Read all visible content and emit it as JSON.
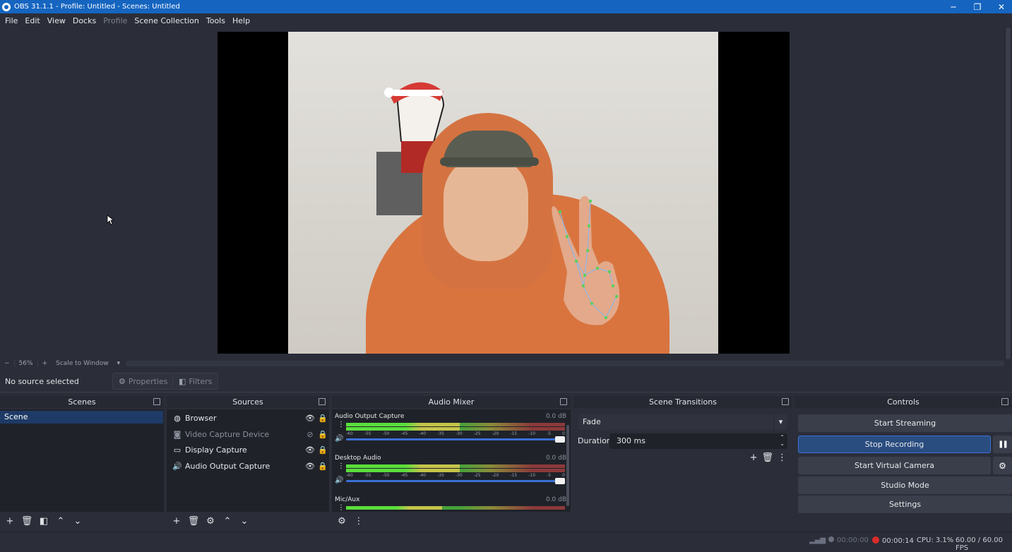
{
  "window": {
    "title": "OBS 31.1.1 - Profile: Untitled - Scenes: Untitled",
    "min_glyph": "─",
    "restore_glyph": "❐",
    "close_glyph": "✕"
  },
  "menubar": {
    "items": [
      "File",
      "Edit",
      "View",
      "Docks",
      "Profile",
      "Scene Collection",
      "Tools",
      "Help"
    ]
  },
  "zoombar": {
    "zoom_out": "−",
    "zoom_level": "56%",
    "zoom_in": "+",
    "scale_mode": "Scale to Window",
    "caret": "▾"
  },
  "source_toolbar": {
    "status": "No source selected",
    "properties_label": "Properties",
    "filters_label": "Filters"
  },
  "scenes": {
    "header": "Scenes",
    "items": [
      "Scene"
    ]
  },
  "sources": {
    "header": "Sources",
    "items": [
      {
        "name": "Browser",
        "icon": "globe-icon",
        "visible": true,
        "locked": true
      },
      {
        "name": "Video Capture Device",
        "icon": "camera-icon",
        "visible": false,
        "locked": true
      },
      {
        "name": "Display Capture",
        "icon": "monitor-icon",
        "visible": true,
        "locked": true
      },
      {
        "name": "Audio Output Capture",
        "icon": "speaker-icon",
        "visible": true,
        "locked": true
      }
    ]
  },
  "mixer": {
    "header": "Audio Mixer",
    "ticks": [
      "-60",
      "-55",
      "-50",
      "-45",
      "-40",
      "-35",
      "-30",
      "-25",
      "-20",
      "-15",
      "-10",
      "-5",
      "0"
    ],
    "channels": [
      {
        "name": "Audio Output Capture",
        "db": "0.0 dB",
        "level": 0.52,
        "volume": 1.0
      },
      {
        "name": "Desktop Audio",
        "db": "0.0 dB",
        "level": 0.52,
        "volume": 1.0
      },
      {
        "name": "Mic/Aux",
        "db": "0.0 dB",
        "level": 0.44,
        "volume": 1.0
      }
    ]
  },
  "transitions": {
    "header": "Scene Transitions",
    "selected": "Fade",
    "duration_label": "Duration",
    "duration_value": "300 ms"
  },
  "controls": {
    "header": "Controls",
    "start_streaming": "Start Streaming",
    "stop_recording": "Stop Recording",
    "start_virtual_camera": "Start Virtual Camera",
    "studio_mode": "Studio Mode",
    "settings": "Settings",
    "pause_glyph": "❚❚",
    "gear_glyph": "⚙"
  },
  "status": {
    "stream_time": "00:00:00",
    "record_time": "00:00:14",
    "cpu": "CPU: 3.1%",
    "fps": "60.00 / 60.00 FPS"
  },
  "colors": {
    "accent": "#1565c0",
    "selected_scene": "#1e3a66",
    "record_red": "#d92b2b",
    "meter_green": "#5bde3c"
  }
}
